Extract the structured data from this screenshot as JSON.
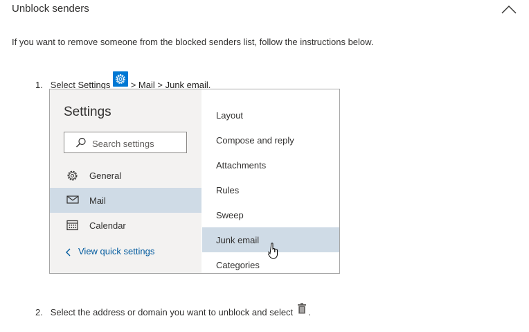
{
  "section": {
    "title": "Unblock senders",
    "intro": "If you want to remove someone from the blocked senders list, follow the instructions below."
  },
  "steps": [
    {
      "number": "1.",
      "prefix": "Select",
      "settings": "Settings",
      "path_sep1": ">",
      "mail": "Mail",
      "path_sep2": ">",
      "junk": "Junk email",
      "end": "."
    },
    {
      "number": "2.",
      "text": "Select the address or domain you want to unblock and select",
      "end": "."
    }
  ],
  "settings_panel": {
    "title": "Settings",
    "search_placeholder": "Search settings",
    "nav": [
      {
        "icon": "gear-icon",
        "label": "General"
      },
      {
        "icon": "mail-icon",
        "label": "Mail",
        "selected": true
      },
      {
        "icon": "calendar-icon",
        "label": "Calendar"
      }
    ],
    "quick_link": "View quick settings",
    "right_items": [
      {
        "label": "Layout"
      },
      {
        "label": "Compose and reply"
      },
      {
        "label": "Attachments"
      },
      {
        "label": "Rules"
      },
      {
        "label": "Sweep"
      },
      {
        "label": "Junk email",
        "selected": true
      },
      {
        "label": "Categories"
      }
    ]
  },
  "colors": {
    "selected_bg": "#cfdbe6",
    "accent": "#0078d4",
    "pane_bg": "#f3f2f1",
    "link": "#005a9e"
  }
}
